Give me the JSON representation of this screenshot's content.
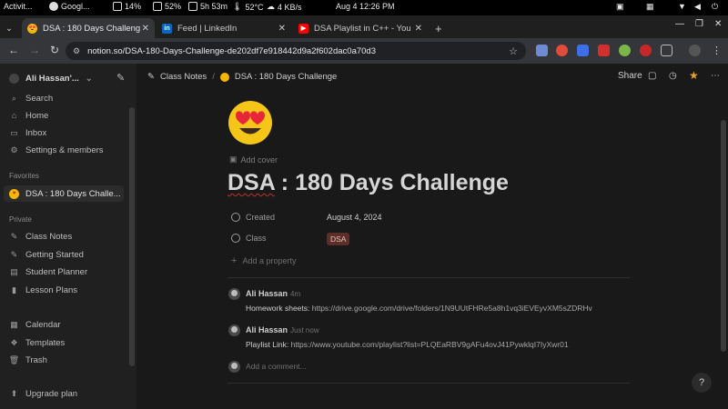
{
  "system_bar": {
    "activities": "Activit...",
    "chrome": "Googl...",
    "battery": "14%",
    "cpu": "52%",
    "time_left": "5h 53m",
    "temp": "52°C",
    "net": "4 KB/s",
    "clock": "Aug 4  12:26 PM"
  },
  "tabs": [
    {
      "label": "DSA : 180 Days Challeng",
      "active": true
    },
    {
      "label": "Feed | LinkedIn",
      "active": false
    },
    {
      "label": "DSA Playlist in C++ - You",
      "active": false
    }
  ],
  "address": {
    "url": "notion.so/DSA-180-Days-Challenge-de202df7e918442d9a2f602dac0a70d3"
  },
  "sidebar": {
    "workspace": "Ali Hassan'...",
    "top_items": [
      {
        "label": "Search",
        "icon": "search-icon"
      },
      {
        "label": "Home",
        "icon": "home-icon"
      },
      {
        "label": "Inbox",
        "icon": "inbox-icon"
      },
      {
        "label": "Settings & members",
        "icon": "gear-icon"
      }
    ],
    "favorites_heading": "Favorites",
    "favorites": [
      {
        "label": "DSA : 180 Days Challe...",
        "icon": "heart-eyes-emoji-icon"
      }
    ],
    "private_heading": "Private",
    "private": [
      {
        "label": "Class Notes",
        "icon": "pencil-icon"
      },
      {
        "label": "Getting Started",
        "icon": "pencil-icon"
      },
      {
        "label": "Student Planner",
        "icon": "calendar-icon"
      },
      {
        "label": "Lesson Plans",
        "icon": "bookmark-icon"
      }
    ],
    "bottom": [
      {
        "label": "Calendar",
        "icon": "calendar-icon"
      },
      {
        "label": "Templates",
        "icon": "templates-icon"
      },
      {
        "label": "Trash",
        "icon": "trash-icon"
      }
    ],
    "upgrade": "Upgrade plan"
  },
  "breadcrumb": {
    "parent": "Class Notes",
    "sep": "/",
    "current": "DSA : 180 Days Challenge"
  },
  "toolbar": {
    "share": "Share"
  },
  "page": {
    "add_cover": "Add cover",
    "title_part1": "DSA",
    "title_part2": " : 180 Days Challenge",
    "properties": {
      "created_label": "Created",
      "created_value": "August 4, 2024",
      "class_label": "Class",
      "class_value": "DSA",
      "add_property": "Add a property"
    },
    "comments": [
      {
        "author": "Ali Hassan",
        "time": "4m",
        "prefix": "Homework sheets: ",
        "link": "https://drive.google.com/drive/folders/1N9UUtFHRe5a8h1vq3iEVEyvXM5sZDRHv"
      },
      {
        "author": "Ali Hassan",
        "time": "Just now",
        "prefix": "Playlist Link: ",
        "link": "https://www.youtube.com/playlist?list=PLQEaRBV9gAFu4ovJ41PywklqI7IyXwr01"
      }
    ],
    "comment_placeholder": "Add a comment...",
    "help": "?"
  }
}
